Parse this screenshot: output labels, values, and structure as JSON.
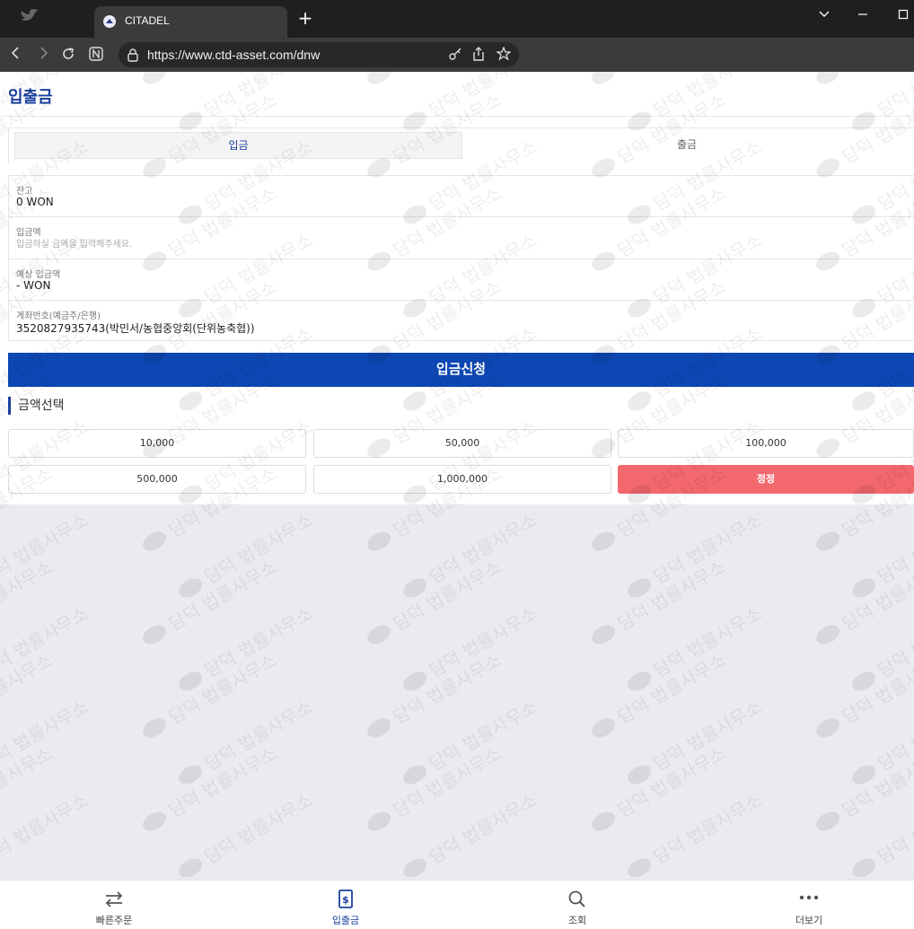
{
  "browser": {
    "tab_title": "CITADEL",
    "url": "https://www.ctd-asset.com/dnw"
  },
  "page": {
    "title": "입출금",
    "tabs": {
      "deposit": "입금",
      "withdraw": "출금"
    },
    "fields": {
      "balance": {
        "label": "잔고",
        "value": "0 WON"
      },
      "deposit_amount": {
        "label": "입금액",
        "placeholder": "입금하실 금액을 입력해주세요."
      },
      "expected": {
        "label": "예상 입금액",
        "value": "- WON"
      },
      "account": {
        "label": "계좌번호(예금주/은행)",
        "value": "3520827935743(박민서/농협중앙회(단위농축협))"
      }
    },
    "submit_label": "입금신청",
    "section_title": "금액선택",
    "amounts": [
      "10,000",
      "50,000",
      "100,000",
      "500,000",
      "1,000,000"
    ],
    "reset_label": "정정"
  },
  "bottom_nav": [
    {
      "label": "빠른주문",
      "icon": "swap-arrows-icon"
    },
    {
      "label": "입출금",
      "icon": "dollar-document-icon"
    },
    {
      "label": "조회",
      "icon": "search-icon"
    },
    {
      "label": "더보기",
      "icon": "more-dots-icon"
    }
  ],
  "watermark": {
    "text": "담덕 법률사무소"
  },
  "colors": {
    "primary": "#0c47b3",
    "reset": "#f2686d",
    "title": "#1a3f9c",
    "background": "#e9ebef"
  }
}
